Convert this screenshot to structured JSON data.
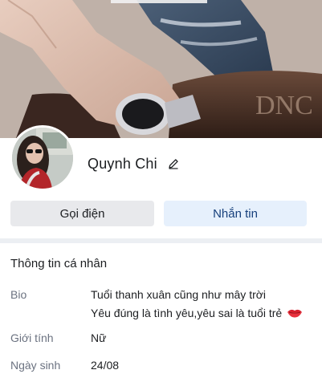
{
  "profile": {
    "name": "Quynh Chi"
  },
  "actions": {
    "call_label": "Gọi điện",
    "message_label": "Nhắn tin"
  },
  "info": {
    "section_title": "Thông tin cá nhân",
    "bio_label": "Bio",
    "bio_line1": "Tuổi thanh xuân cũng như mây trời",
    "bio_line2": "Yêu đúng là tình yêu,yêu sai là tuổi trẻ",
    "gender_label": "Giới tính",
    "gender_value": "Nữ",
    "birthday_label": "Ngày sinh",
    "birthday_value": "24/08"
  },
  "icons": {
    "edit": "pencil-icon",
    "bio_emoji": "kiss-mark-icon"
  },
  "colors": {
    "message_button_bg": "#e6f0fc",
    "message_button_text": "#17407c",
    "call_button_bg": "#e8e9ec",
    "divider": "#eceff3"
  }
}
